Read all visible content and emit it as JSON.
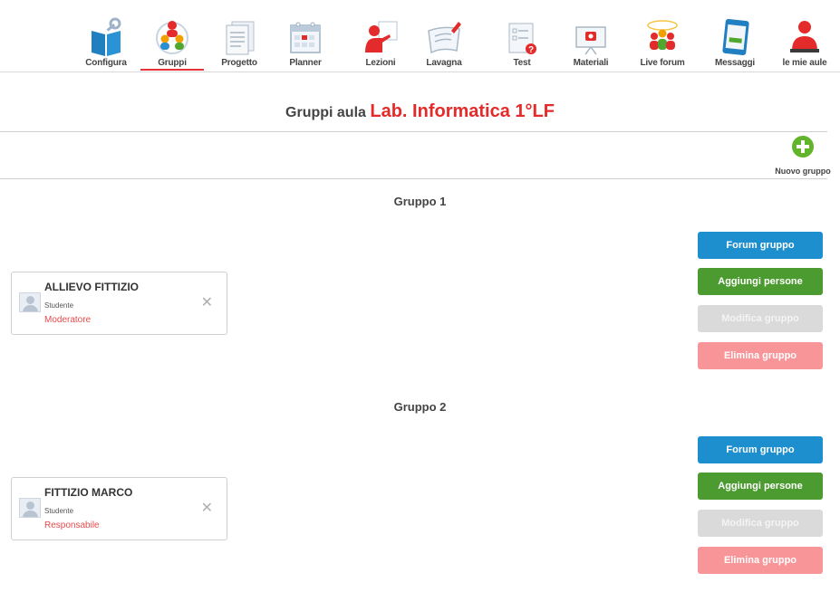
{
  "nav": {
    "items": [
      {
        "label": "Configura"
      },
      {
        "label": "Gruppi"
      },
      {
        "label": "Progetto"
      },
      {
        "label": "Planner"
      },
      {
        "label": "Lezioni"
      },
      {
        "label": "Lavagna"
      },
      {
        "label": "Test"
      },
      {
        "label": "Materiali"
      },
      {
        "label": "Live forum"
      },
      {
        "label": "Messaggi"
      },
      {
        "label": "le mie aule"
      }
    ],
    "active": "Gruppi"
  },
  "header": {
    "prefix": "Gruppi aula",
    "classroom": "Lab. Informatica 1°LF"
  },
  "new_group": {
    "label": "Nuovo gruppo"
  },
  "groups": [
    {
      "title": "Gruppo 1",
      "member": {
        "name": "ALLIEVO FITTIZIO",
        "role": "Studente",
        "tag": "Moderatore"
      },
      "buttons": {
        "forum": "Forum gruppo",
        "add": "Aggiungi persone",
        "edit": "Modifica gruppo",
        "delete": "Elimina gruppo"
      }
    },
    {
      "title": "Gruppo 2",
      "member": {
        "name": "FITTIZIO MARCO",
        "role": "Studente",
        "tag": "Responsabile"
      },
      "buttons": {
        "forum": "Forum gruppo",
        "add": "Aggiungi persone",
        "edit": "Modifica gruppo",
        "delete": "Elimina gruppo"
      }
    }
  ],
  "colors": {
    "accent_red": "#e52a2a",
    "forum_blue": "#1d8fce",
    "add_green": "#4c9b30",
    "edit_gray": "#dadada",
    "delete_pink": "#f79598"
  }
}
